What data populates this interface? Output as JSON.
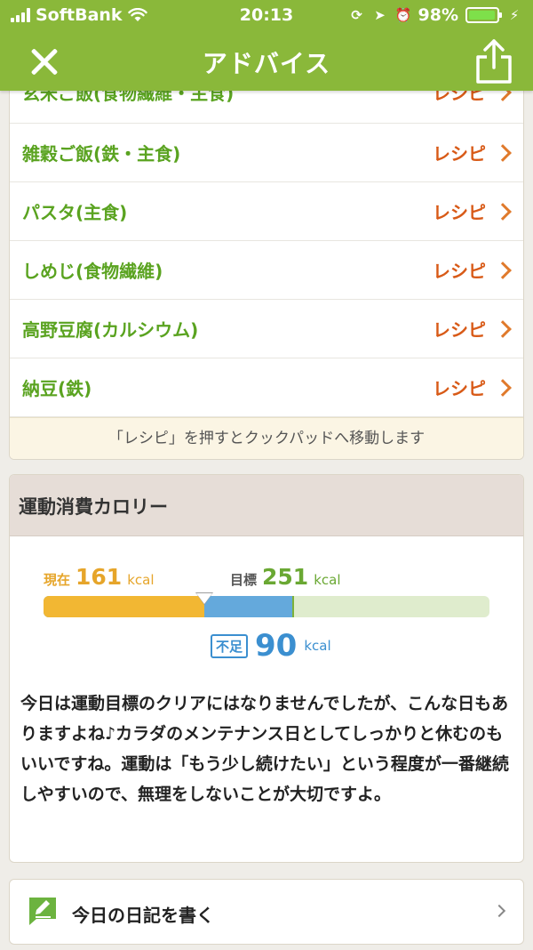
{
  "status_bar": {
    "carrier": "SoftBank",
    "time": "20:13",
    "battery": "98%"
  },
  "nav": {
    "title": "アドバイス"
  },
  "recipes": [
    {
      "food": "玄米ご飯(食物繊維・主食)",
      "link": "レシピ"
    },
    {
      "food": "雑穀ご飯(鉄・主食)",
      "link": "レシピ"
    },
    {
      "food": "パスタ(主食)",
      "link": "レシピ"
    },
    {
      "food": "しめじ(食物繊維)",
      "link": "レシピ"
    },
    {
      "food": "高野豆腐(カルシウム)",
      "link": "レシピ"
    },
    {
      "food": "納豆(鉄)",
      "link": "レシピ"
    }
  ],
  "recipe_note": "「レシピ」を押すとクックパッドへ移動します",
  "exercise": {
    "heading": "運動消費カロリー",
    "current_label": "現在",
    "current_value": "161",
    "target_label": "目標",
    "target_value": "251",
    "unit": "kcal",
    "shortage_label": "不足",
    "shortage_value": "90",
    "current_fraction": 0.36,
    "target_fraction": 0.56,
    "colors": {
      "current": "#f2b733",
      "target": "#64a9dc",
      "track": "#dfeccd"
    },
    "message": "今日は運動目標のクリアにはなりませんでしたが、こんな日もありますよね♪カラダのメンテナンス日としてしっかりと休むのもいいですね。運動は「もう少し続けたい」という程度が一番継続しやすいので、無理をしないことが大切ですよ。"
  },
  "diary": {
    "label": "今日の日記を書く"
  },
  "icons": {
    "close": "close-icon",
    "share": "share-icon",
    "diary": "pencil-note-icon",
    "chevron": "chevron-right-icon"
  },
  "brand_color": "#8ab83a"
}
